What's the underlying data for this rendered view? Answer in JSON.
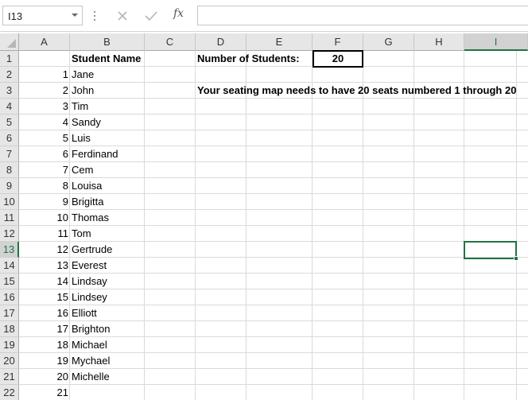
{
  "formula_bar": {
    "name_box": "I13",
    "formula": ""
  },
  "grid": {
    "columns": [
      "A",
      "B",
      "C",
      "D",
      "E",
      "F",
      "G",
      "H",
      "I"
    ],
    "rows": [
      "1",
      "2",
      "3",
      "4",
      "5",
      "6",
      "7",
      "8",
      "9",
      "10",
      "11",
      "12",
      "13",
      "14",
      "15",
      "16",
      "17",
      "18",
      "19",
      "20",
      "21",
      "22"
    ],
    "selected_column": "I",
    "selected_row": "13"
  },
  "cells": {
    "B1": "Student Name",
    "D1": "Number of Students:",
    "F1": "20",
    "D3": "Your seating map needs to have 20 seats numbered 1 through 20",
    "numbers": [
      "1",
      "2",
      "3",
      "4",
      "5",
      "6",
      "7",
      "8",
      "9",
      "10",
      "11",
      "12",
      "13",
      "14",
      "15",
      "16",
      "17",
      "18",
      "19",
      "20",
      "21"
    ],
    "students": [
      "Jane",
      "John",
      "Tim",
      "Sandy",
      "Luis",
      "Ferdinand",
      "Cem",
      "Louisa",
      "Brigitta",
      "Thomas",
      "Tom",
      "Gertrude",
      "Everest",
      "Lindsay",
      "Lindsey",
      "Elliott",
      "Brighton",
      "Michael",
      "Mychael",
      "Michelle"
    ]
  },
  "colors": {
    "accent": "#217346",
    "header_bg": "#e6e6e6",
    "gridline": "#dadada"
  }
}
